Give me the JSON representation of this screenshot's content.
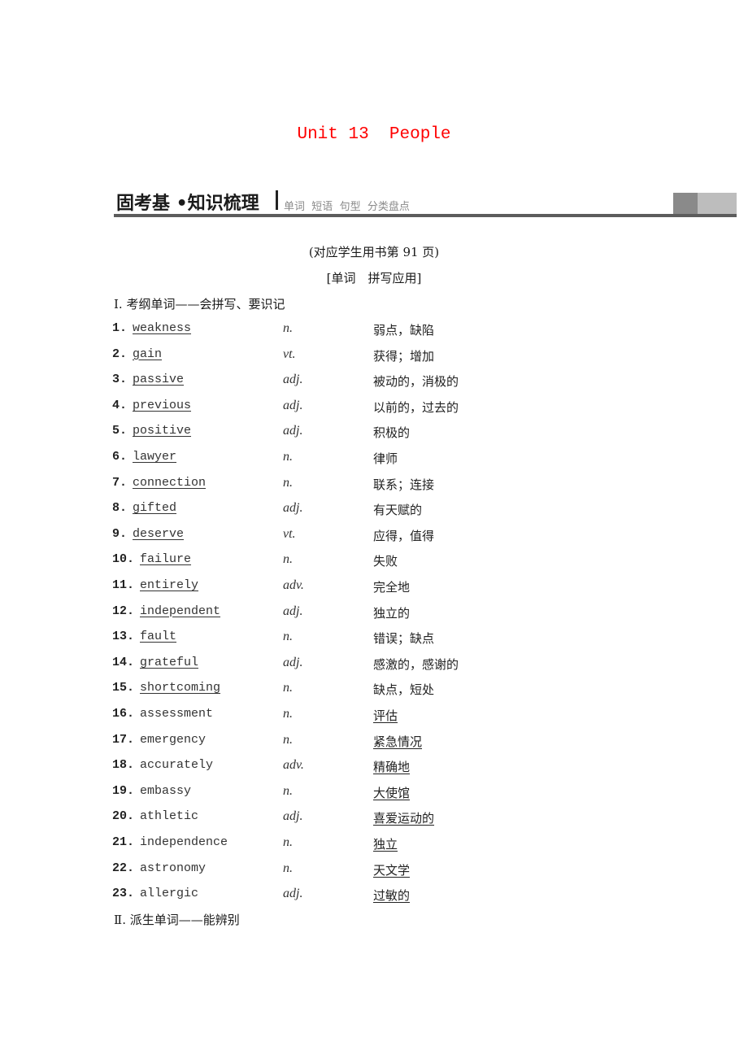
{
  "title": {
    "unit": "Unit 13",
    "topic": "People"
  },
  "section_header": {
    "main": "固考基 •知识梳理",
    "tags": [
      "单词",
      "短语",
      "句型",
      "分类盘点"
    ]
  },
  "reference": "(对应学生用书第 91 页)",
  "subtitle": "[单词　拼写应用]",
  "part1_heading": "Ⅰ. 考纲单词——会拼写、要识记",
  "part2_heading": "Ⅱ. 派生单词——能辨别",
  "words": [
    {
      "num": "1.",
      "word": "weakness",
      "pos": "n.",
      "meaning": "弱点，缺陷",
      "answer": "word"
    },
    {
      "num": "2.",
      "word": "gain",
      "pos": "vt.",
      "meaning": "获得；增加",
      "answer": "word"
    },
    {
      "num": "3.",
      "word": "passive",
      "pos": "adj.",
      "meaning": "被动的，消极的",
      "answer": "word"
    },
    {
      "num": "4.",
      "word": "previous",
      "pos": "adj.",
      "meaning": "以前的，过去的",
      "answer": "word"
    },
    {
      "num": "5.",
      "word": "positive",
      "pos": "adj.",
      "meaning": "积极的",
      "answer": "word"
    },
    {
      "num": "6.",
      "word": "lawyer",
      "pos": "n.",
      "meaning": "律师",
      "answer": "word"
    },
    {
      "num": "7.",
      "word": "connection",
      "pos": "n.",
      "meaning": "联系；连接",
      "answer": "word"
    },
    {
      "num": "8.",
      "word": "gifted",
      "pos": "adj.",
      "meaning": "有天赋的",
      "answer": "word"
    },
    {
      "num": "9.",
      "word": "deserve",
      "pos": "vt.",
      "meaning": "应得，值得",
      "answer": "word"
    },
    {
      "num": "10.",
      "word": "failure",
      "pos": "n.",
      "meaning": "失败",
      "answer": "word"
    },
    {
      "num": "11.",
      "word": "entirely",
      "pos": "adv.",
      "meaning": "完全地",
      "answer": "word"
    },
    {
      "num": "12.",
      "word": "independent",
      "pos": "adj.",
      "meaning": "独立的",
      "answer": "word"
    },
    {
      "num": "13.",
      "word": "fault",
      "pos": "n.",
      "meaning": "错误；缺点",
      "answer": "word"
    },
    {
      "num": "14.",
      "word": "grateful",
      "pos": "adj.",
      "meaning": "感激的，感谢的",
      "answer": "word"
    },
    {
      "num": "15.",
      "word": "shortcoming",
      "pos": "n.",
      "meaning": "缺点，短处",
      "answer": "word"
    },
    {
      "num": "16.",
      "word": "assessment",
      "pos": "n.",
      "meaning": "评估",
      "answer": "meaning"
    },
    {
      "num": "17.",
      "word": "emergency",
      "pos": "n.",
      "meaning": "紧急情况",
      "answer": "meaning"
    },
    {
      "num": "18.",
      "word": "accurately",
      "pos": "adv.",
      "meaning": "精确地",
      "answer": "meaning"
    },
    {
      "num": "19.",
      "word": "embassy",
      "pos": "n.",
      "meaning": "大使馆",
      "answer": "meaning"
    },
    {
      "num": "20.",
      "word": "athletic",
      "pos": "adj.",
      "meaning": "喜爱运动的",
      "answer": "meaning"
    },
    {
      "num": "21.",
      "word": "independence",
      "pos": "n.",
      "meaning": "独立",
      "answer": "meaning"
    },
    {
      "num": "22.",
      "word": "astronomy",
      "pos": "n.",
      "meaning": "天文学",
      "answer": "meaning"
    },
    {
      "num": "23.",
      "word": "allergic",
      "pos": "adj.",
      "meaning": "过敏的",
      "answer": "meaning"
    }
  ]
}
